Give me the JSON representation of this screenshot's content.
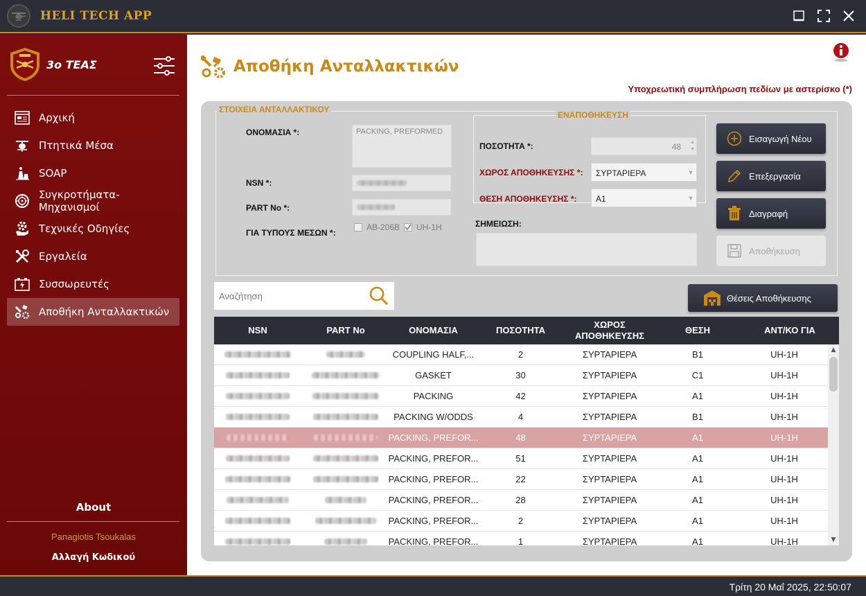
{
  "app": {
    "title": "HELI TECH APP"
  },
  "window_controls": [
    "minimize",
    "maximize",
    "close"
  ],
  "sidebar": {
    "team": "3ο ΤΕΑΣ",
    "items": [
      {
        "label": "Αρχική",
        "icon": "dashboard-icon"
      },
      {
        "label": "Πτητικά Μέσα",
        "icon": "helicopter-icon"
      },
      {
        "label": "SOAP",
        "icon": "soap-icon"
      },
      {
        "label": "Συγκροτήματα-Μηχανισμοί",
        "icon": "engine-icon"
      },
      {
        "label": "Τεχνικές Οδηγίες",
        "icon": "instructions-icon"
      },
      {
        "label": "Εργαλεία",
        "icon": "tools-icon"
      },
      {
        "label": "Συσσωρευτές",
        "icon": "battery-icon"
      },
      {
        "label": "Αποθήκη Ανταλλακτικών",
        "icon": "parts-icon",
        "active": true
      }
    ],
    "about": "About",
    "user": "Panagiotis Tsoukalas",
    "change_password": "Αλλαγή Κωδικού"
  },
  "main": {
    "title": "Αποθήκη Ανταλλακτικών",
    "mandatory_note": "Υποχρεωτική συμπλήρωση πεδίων με αστερίσκο (*)",
    "form": {
      "group_title": "ΣΤΟΙΧΕΙΑ ΑΝΤΑΛΛΑΚΤΙΚΟΥ",
      "name_label": "ΟΝΟΜΑΣΙΑ *:",
      "name_value": "PACKING, PREFORMED",
      "nsn_label": "NSN *:",
      "part_label": "PART No *:",
      "types_label": "ΓΙΑ ΤΥΠΟΥΣ ΜΕΣΩΝ *:",
      "type_options": [
        {
          "label": "AB-206B",
          "checked": false
        },
        {
          "label": "UH-1H",
          "checked": true
        }
      ],
      "storage_group_title": "ΕΝΑΠΟΘΗΚΕΥΣΗ",
      "qty_label": "ΠΟΣΟΤΗΤΑ *:",
      "qty_value": "48",
      "location_label": "ΧΩΡΟΣ ΑΠΟΘΗΚΕΥΣΗΣ *:",
      "location_value": "ΣΥΡΤΑΡΙΕΡΑ",
      "position_label": "ΘΕΣΗ ΑΠΟΘΗΚΕΥΣΗΣ *:",
      "position_value": "A1",
      "note_label": "ΣΗΜΕΙΩΣΗ:",
      "note_value": ""
    },
    "buttons": {
      "new": "Εισαγωγή Νέου",
      "edit": "Επεξεργασία",
      "delete": "Διαγραφή",
      "save": "Αποθήκευση",
      "storage_positions": "Θέσεις Αποθήκευσης"
    },
    "search": {
      "placeholder": "Αναζήτηση"
    },
    "table": {
      "columns": [
        "NSN",
        "PART No",
        "ΟΝΟΜΑΣΙΑ",
        "ΠΟΣΟΤΗΤΑ",
        "ΧΩΡΟΣ ΑΠΟΘΗΚΕΥΣΗΣ",
        "ΘΕΣΗ",
        "ΑΝΤ/ΚΟ ΓΙΑ"
      ],
      "rows": [
        {
          "name": "COUPLING HALF,...",
          "qty": "2",
          "location": "ΣΥΡΤΑΡΙΕΡΑ",
          "position": "B1",
          "for": "UH-1H"
        },
        {
          "name": "GASKET",
          "qty": "30",
          "location": "ΣΥΡΤΑΡΙΕΡΑ",
          "position": "C1",
          "for": "UH-1H"
        },
        {
          "name": "PACKING",
          "qty": "42",
          "location": "ΣΥΡΤΑΡΙΕΡΑ",
          "position": "A1",
          "for": "UH-1H"
        },
        {
          "name": "PACKING W/ODDS",
          "qty": "4",
          "location": "ΣΥΡΤΑΡΙΕΡΑ",
          "position": "B1",
          "for": "UH-1H"
        },
        {
          "name": "PACKING, PREFOR...",
          "qty": "48",
          "location": "ΣΥΡΤΑΡΙΕΡΑ",
          "position": "A1",
          "for": "UH-1H",
          "selected": true
        },
        {
          "name": "PACKING, PREFOR...",
          "qty": "51",
          "location": "ΣΥΡΤΑΡΙΕΡΑ",
          "position": "A1",
          "for": "UH-1H"
        },
        {
          "name": "PACKING, PREFOR...",
          "qty": "22",
          "location": "ΣΥΡΤΑΡΙΕΡΑ",
          "position": "A1",
          "for": "UH-1H"
        },
        {
          "name": "PACKING, PREFOR...",
          "qty": "28",
          "location": "ΣΥΡΤΑΡΙΕΡΑ",
          "position": "A1",
          "for": "UH-1H"
        },
        {
          "name": "PACKING, PREFOR...",
          "qty": "2",
          "location": "ΣΥΡΤΑΡΙΕΡΑ",
          "position": "A1",
          "for": "UH-1H"
        },
        {
          "name": "PACKING, PREFOR...",
          "qty": "1",
          "location": "ΣΥΡΤΑΡΙΕΡΑ",
          "position": "A1",
          "for": "UH-1H"
        }
      ]
    }
  },
  "statusbar": {
    "datetime": "Τρίτη 20 Μαΐ 2025, 22:50:07"
  },
  "colors": {
    "accent": "#c98a17",
    "sidebar": "#7d0d0d",
    "dark": "#2b2e37",
    "selected_row": "#d9a3a4"
  }
}
